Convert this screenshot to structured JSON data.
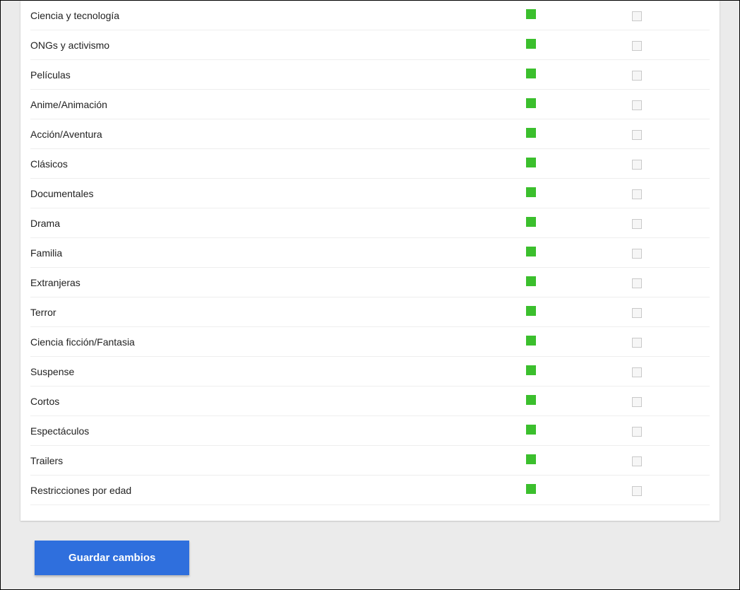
{
  "rows": [
    {
      "label": "Ciencia y tecnología"
    },
    {
      "label": "ONGs y activismo"
    },
    {
      "label": "Películas"
    },
    {
      "label": "Anime/Animación"
    },
    {
      "label": "Acción/Aventura"
    },
    {
      "label": "Clásicos"
    },
    {
      "label": "Documentales"
    },
    {
      "label": "Drama"
    },
    {
      "label": "Familia"
    },
    {
      "label": "Extranjeras"
    },
    {
      "label": "Terror"
    },
    {
      "label": "Ciencia ficción/Fantasia"
    },
    {
      "label": "Suspense"
    },
    {
      "label": "Cortos"
    },
    {
      "label": "Espectáculos"
    },
    {
      "label": "Trailers"
    },
    {
      "label": "Restricciones por edad"
    }
  ],
  "buttons": {
    "save": "Guardar cambios"
  }
}
